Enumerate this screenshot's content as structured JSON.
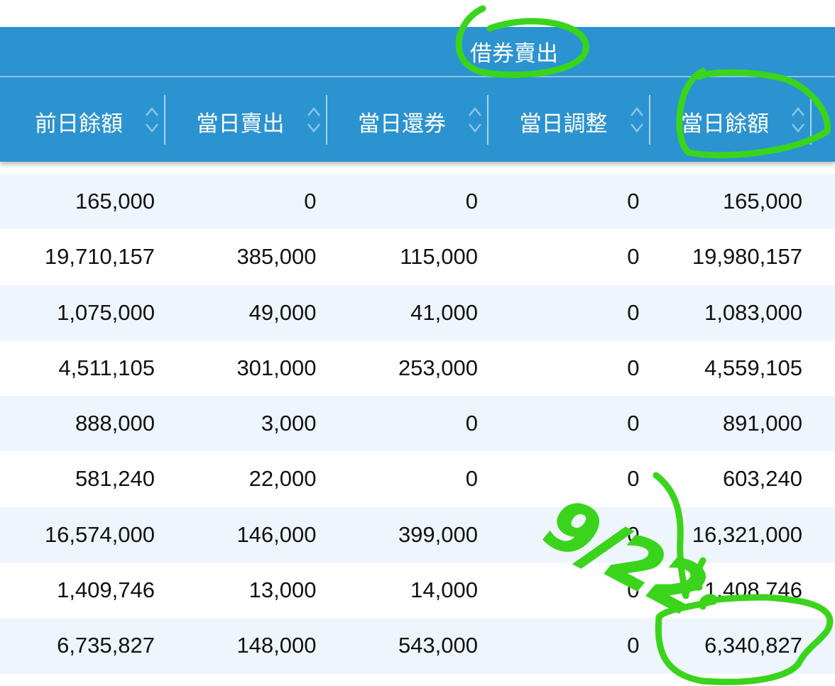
{
  "group_header": "借券賣出",
  "columns": [
    "前日餘額",
    "當日賣出",
    "當日還券",
    "當日調整",
    "當日餘額"
  ],
  "rows": [
    [
      "165,000",
      "0",
      "0",
      "0",
      "165,000"
    ],
    [
      "19,710,157",
      "385,000",
      "115,000",
      "0",
      "19,980,157"
    ],
    [
      "1,075,000",
      "49,000",
      "41,000",
      "0",
      "1,083,000"
    ],
    [
      "4,511,105",
      "301,000",
      "253,000",
      "0",
      "4,559,105"
    ],
    [
      "888,000",
      "3,000",
      "0",
      "0",
      "891,000"
    ],
    [
      "581,240",
      "22,000",
      "0",
      "0",
      "603,240"
    ],
    [
      "16,574,000",
      "146,000",
      "399,000",
      "0",
      "16,321,000"
    ],
    [
      "1,409,746",
      "13,000",
      "14,000",
      "0",
      "1,408,746"
    ],
    [
      "6,735,827",
      "148,000",
      "543,000",
      "0",
      "6,340,827"
    ]
  ],
  "annotation": {
    "text": "9/22",
    "color": "#3ad41c"
  },
  "colors": {
    "header": "#2b93cf",
    "row_alt": "#eef5fd"
  }
}
